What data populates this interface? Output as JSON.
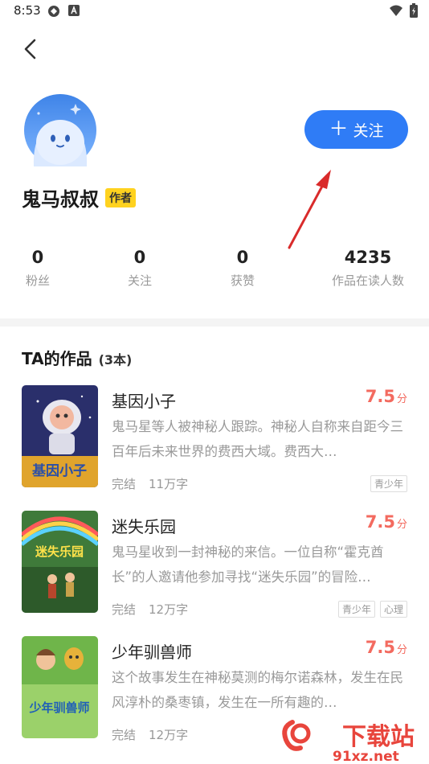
{
  "status": {
    "time": "8:53"
  },
  "profile": {
    "name": "鬼马叔叔",
    "badge": "作者",
    "follow_label": "关注"
  },
  "stats": [
    {
      "value": "0",
      "label": "粉丝"
    },
    {
      "value": "0",
      "label": "关注"
    },
    {
      "value": "0",
      "label": "获赞"
    },
    {
      "value": "4235",
      "label": "作品在读人数"
    }
  ],
  "works": {
    "title": "TA的作品",
    "count": "(3本)",
    "books": [
      {
        "title": "基因小子",
        "score": "7.5",
        "score_unit": "分",
        "desc": "鬼马星等人被神秘人跟踪。神秘人自称来自距今三百年后未来世界的费西大域。费西大…",
        "status": "完结",
        "words": "11万字",
        "tags": [
          "青少年"
        ],
        "cover_text": "基因小子"
      },
      {
        "title": "迷失乐园",
        "score": "7.5",
        "score_unit": "分",
        "desc": "鬼马星收到一封神秘的来信。一位自称“霍克酋长”的人邀请他参加寻找“迷失乐园”的冒险…",
        "status": "完结",
        "words": "12万字",
        "tags": [
          "青少年",
          "心理"
        ],
        "cover_text": "迷失乐园"
      },
      {
        "title": "少年驯兽师",
        "score": "7.5",
        "score_unit": "分",
        "desc": "这个故事发生在神秘莫测的梅尔诺森林，发生在民风淳朴的桑枣镇，发生在一所有趣的…",
        "status": "完结",
        "words": "12万字",
        "tags": [],
        "cover_text": "少年驯兽师"
      }
    ]
  },
  "watermark": {
    "big": "下载站",
    "small": "91xz.net"
  },
  "colors": {
    "accent": "#2f7cf6",
    "score": "#f36a5f",
    "badge": "#ffd21f"
  }
}
